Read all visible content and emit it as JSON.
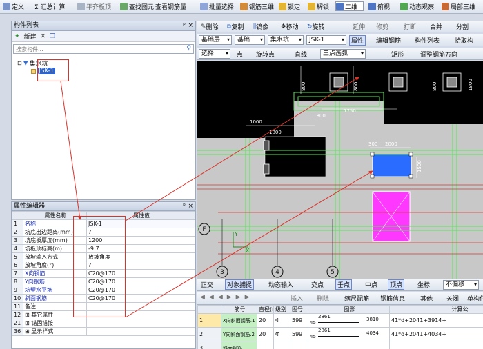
{
  "top_toolbar": {
    "define": "定义",
    "sum": "Σ 汇总计算",
    "flat_panel": "平齐板顶",
    "find": "查找图元",
    "view_rebar": "查看钢筋量",
    "batch_select": "批量选择",
    "rebar_3d": "钢筋三维",
    "lock": "锁定",
    "unlock": "解锁",
    "view_2d": "二维",
    "top_view": "俯视",
    "dynamic_view": "动态观察",
    "local_3d": "局部三维"
  },
  "edit_toolbar": {
    "delete": "删除",
    "copy": "复制",
    "mirror": "镜像",
    "move": "移动",
    "rotate": "旋转",
    "extend": "延伸",
    "trim": "修剪",
    "break": "打断",
    "merge": "合并",
    "split": "分割"
  },
  "layer_toolbar": {
    "layer": "基础层",
    "category": "基础",
    "type": "集水坑",
    "component": "JSK-1",
    "properties": "属性",
    "edit_rebar": "编辑钢筋",
    "component_list": "构件列表",
    "pick": "拾取构"
  },
  "draw_toolbar": {
    "select": "选择",
    "point": "点",
    "rotate_point": "旋转点",
    "line": "直线",
    "three_point_arc": "三点画弧",
    "rectangle": "矩形",
    "adjust_direction": "调整钢筋方向"
  },
  "component_list": {
    "title": "构件列表",
    "new": "新建",
    "search_placeholder": "搜索构件...",
    "tree_parent": "集水坑",
    "tree_child": "JSK-1"
  },
  "property_editor": {
    "title": "属性编辑器",
    "headers": [
      "属性名称",
      "属性值"
    ],
    "rows": [
      {
        "num": "1",
        "name": "名称",
        "value": "JSK-1",
        "blue": true
      },
      {
        "num": "2",
        "name": "坑底出边距离(mm)",
        "value": "?",
        "blue": false
      },
      {
        "num": "3",
        "name": "坑底板厚度(mm)",
        "value": "1200",
        "blue": false
      },
      {
        "num": "4",
        "name": "坑板顶标高(m)",
        "value": "-9.7",
        "blue": false
      },
      {
        "num": "5",
        "name": "放坡输入方式",
        "value": "放坡角度",
        "blue": false
      },
      {
        "num": "6",
        "name": "放坡角度(°)",
        "value": "?",
        "blue": false
      },
      {
        "num": "7",
        "name": "X向钢筋",
        "value": "C20@170",
        "blue": true
      },
      {
        "num": "8",
        "name": "Y向钢筋",
        "value": "C20@170",
        "blue": true
      },
      {
        "num": "9",
        "name": "坑壁水平筋",
        "value": "C20@170",
        "blue": true
      },
      {
        "num": "10",
        "name": "斜面钢筋",
        "value": "C20@170",
        "blue": true
      },
      {
        "num": "11",
        "name": "备注",
        "value": "",
        "blue": false
      },
      {
        "num": "12",
        "name": "⊞ 其它属性",
        "value": "",
        "blue": false
      },
      {
        "num": "21",
        "name": "⊞ 锚固搭接",
        "value": "",
        "blue": false
      },
      {
        "num": "36",
        "name": "⊞ 显示样式",
        "value": "",
        "blue": false
      }
    ]
  },
  "drawing": {
    "dims": [
      "1000",
      "1750",
      "300",
      "2000",
      "800",
      "800",
      "800",
      "1800",
      "1800",
      "1500",
      "1800"
    ],
    "axis_labels": [
      "F",
      "3",
      "4",
      "5"
    ],
    "axis_y": "Y",
    "axis_x": "X"
  },
  "snap_toolbar": {
    "ortho": "正交",
    "object_snap": "对象捕捉",
    "dynamic_input": "动态输入",
    "intersection": "交点",
    "perpendicular": "垂点",
    "midpoint": "中点",
    "vertex": "顶点",
    "coord": "坐标",
    "no_offset": "不偏移"
  },
  "rebar_toolbar": {
    "insert": "插入",
    "delete": "删除",
    "scale_rebar": "缩尺配筋",
    "rebar_info": "钢筋信息",
    "other": "其他",
    "close": "关闭",
    "single_weight": "单构件"
  },
  "rebar_table": {
    "headers": [
      "筋号",
      "直径(mm)",
      "级别",
      "图号",
      "图形",
      "计算公"
    ],
    "rows": [
      {
        "num": "1",
        "name": "X向斜面钢筋.1",
        "dia": "20",
        "grade": "Φ",
        "fig": "599",
        "shape_a": "2861",
        "shape_b": "45",
        "shape_c": "3810",
        "formula": "41*d+2041+3914+"
      },
      {
        "num": "2",
        "name": "Y向斜面钢筋.2",
        "dia": "20",
        "grade": "Φ",
        "fig": "599",
        "shape_a": "2861",
        "shape_b": "45",
        "shape_c": "4034",
        "formula": "41*d+2041+4034+"
      },
      {
        "num": "3",
        "name": "斜面钢筋",
        "dia": "",
        "grade": "",
        "fig": "",
        "shape_a": "",
        "shape_b": "",
        "shape_c": "",
        "formula": ""
      }
    ]
  },
  "colors": {
    "canvas": "#000000",
    "slab": "#c8c8c8",
    "pit_selected": "#2a6cff",
    "pit_pink": "#ff38ff",
    "green_line": "#5ee05e",
    "red_arrow": "#d9342b"
  }
}
